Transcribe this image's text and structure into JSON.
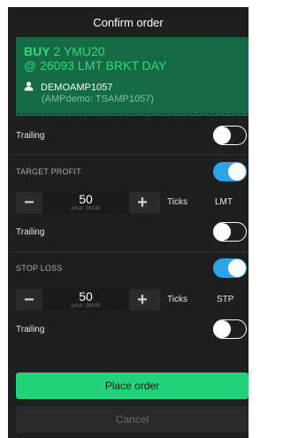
{
  "header": {
    "title": "Confirm order"
  },
  "ticket": {
    "action": "BUY",
    "line1_rest": "2 YMU20",
    "line2": "@ 26093 LMT BRKT DAY",
    "user_icon": "user-icon",
    "account": "DEMOAMP1057",
    "account_detail": "(AMPdemo: TSAMP1057)"
  },
  "trailing_main": {
    "label": "Trailing",
    "on": false
  },
  "target_profit": {
    "section_label": "TARGET PROFIT",
    "enabled": true,
    "value": "50",
    "price": "price: 26143",
    "unit": "Ticks",
    "type": "LMT",
    "trailing_label": "Trailing",
    "trailing_on": false
  },
  "stop_loss": {
    "section_label": "STOP LOSS",
    "enabled": true,
    "value": "50",
    "price": "price: 26043",
    "unit": "Ticks",
    "type": "STP",
    "trailing_label": "Trailing",
    "trailing_on": false
  },
  "buttons": {
    "place": "Place order",
    "cancel": "Cancel"
  },
  "colors": {
    "accent_green": "#22d37a",
    "toggle_blue": "#2ea4e8",
    "ticket_bg": "#146b45"
  }
}
